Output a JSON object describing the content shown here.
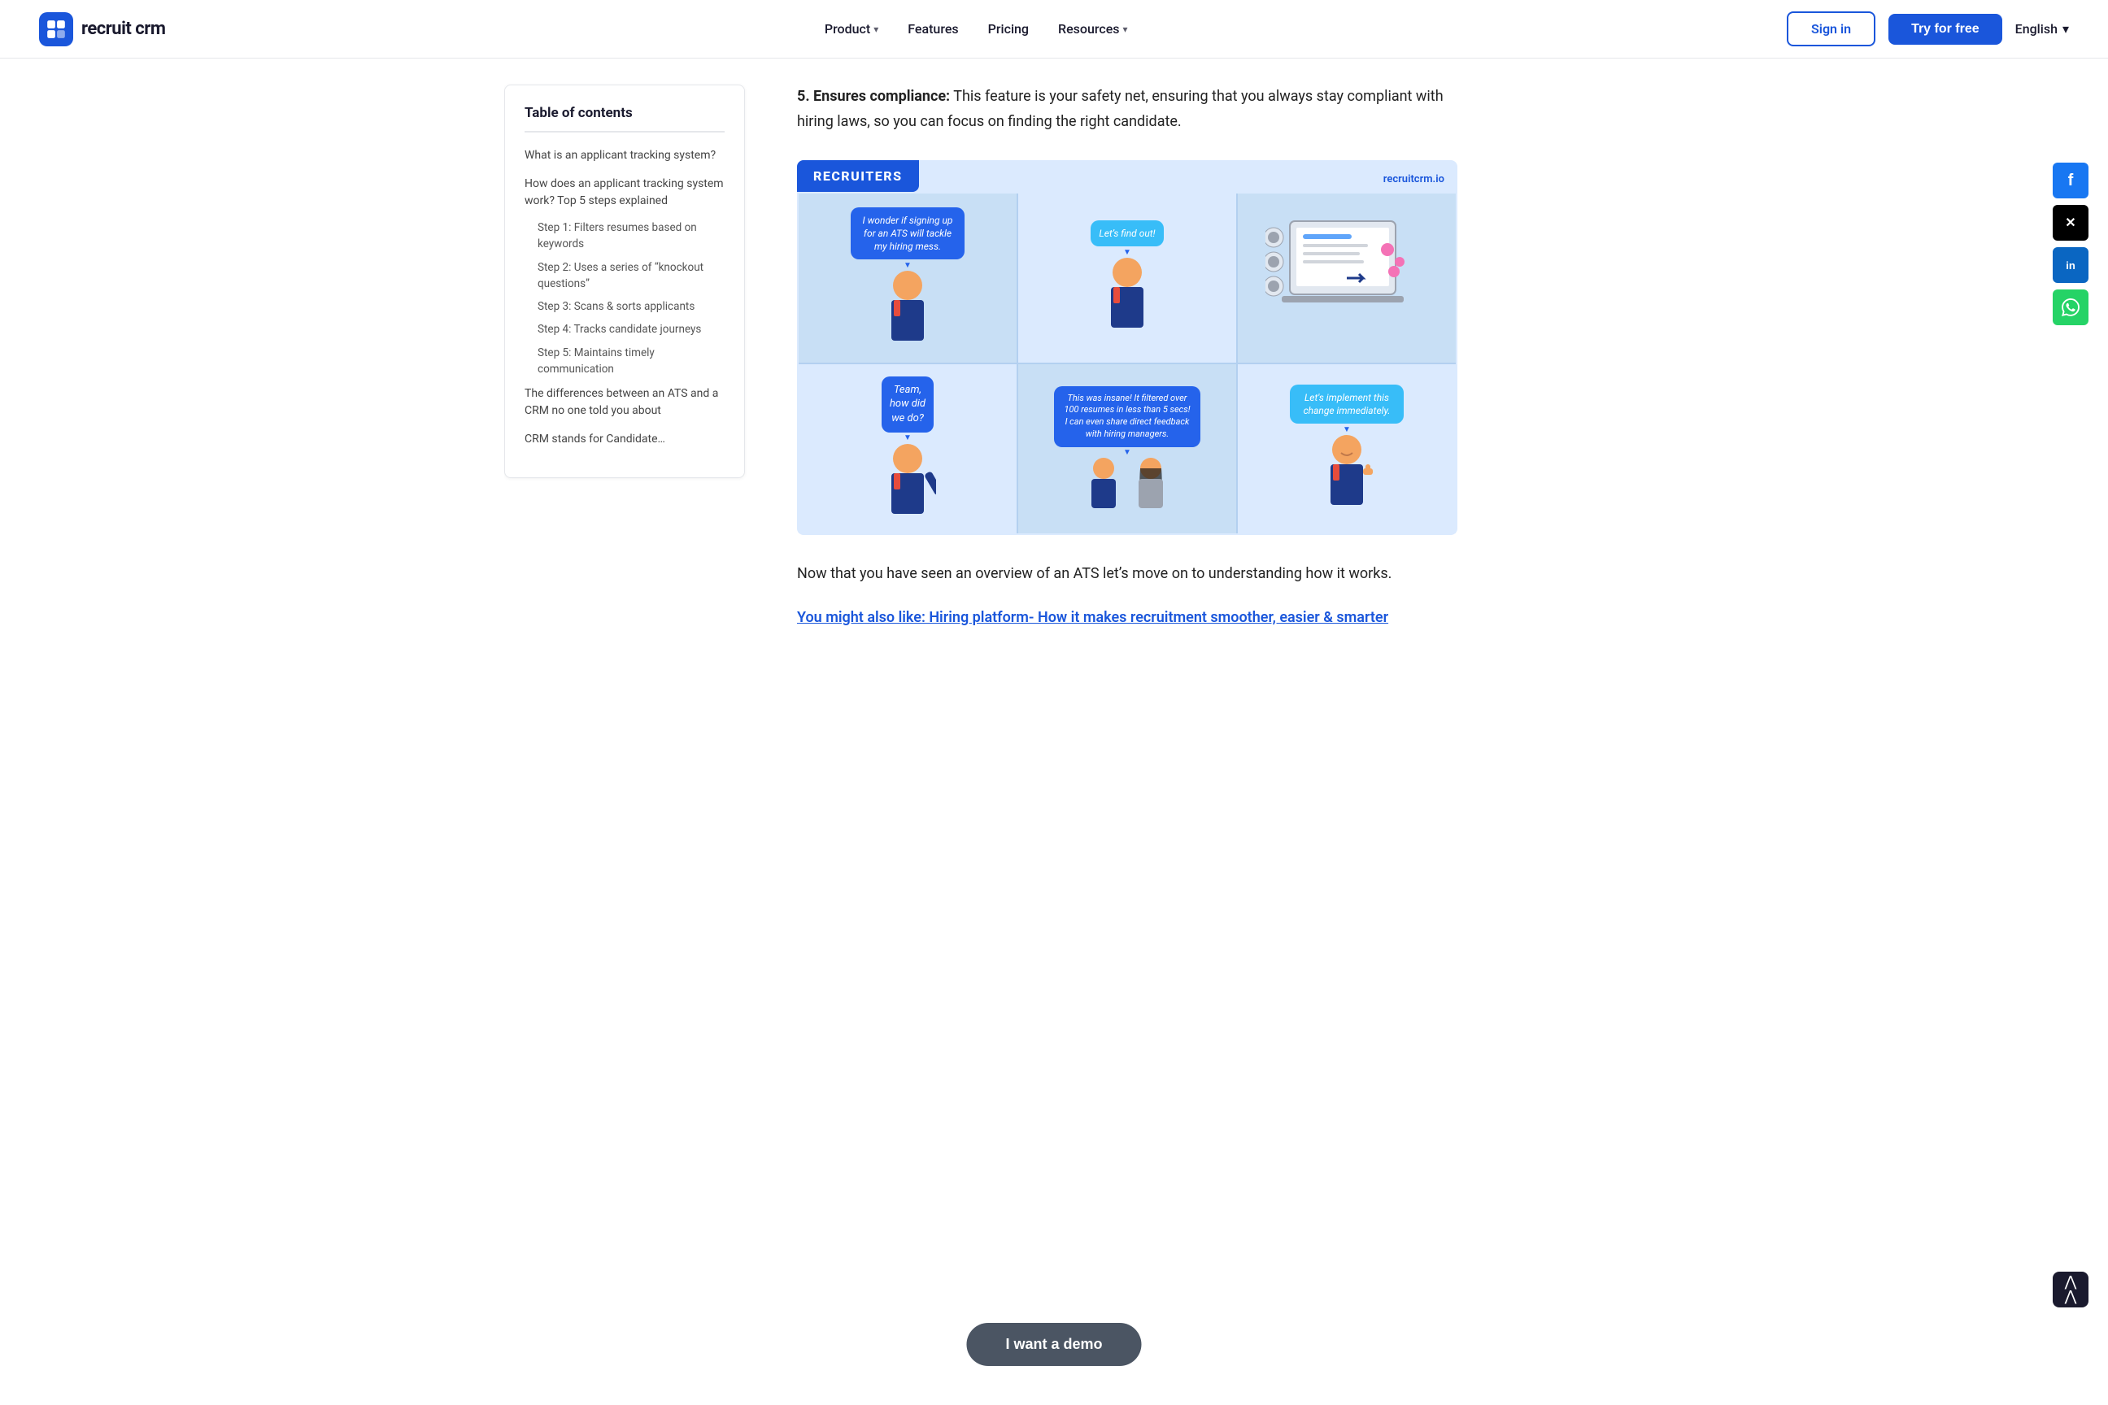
{
  "navbar": {
    "logo_text": "recruit crm",
    "nav_links": [
      {
        "label": "Product",
        "has_dropdown": true
      },
      {
        "label": "Features",
        "has_dropdown": false
      },
      {
        "label": "Pricing",
        "has_dropdown": false
      },
      {
        "label": "Resources",
        "has_dropdown": true
      }
    ],
    "signin_label": "Sign in",
    "try_label": "Try for free",
    "language": "English"
  },
  "toc": {
    "title": "Table of contents",
    "items": [
      {
        "label": "What is an applicant tracking system?",
        "indent": false
      },
      {
        "label": "How does an applicant tracking system work? Top 5 steps explained",
        "indent": false
      },
      {
        "label": "Step 1: Filters resumes based on keywords",
        "indent": true
      },
      {
        "label": "Step 2: Uses a series of “knockout questions”",
        "indent": true
      },
      {
        "label": "Step 3: Scans & sorts applicants",
        "indent": true
      },
      {
        "label": "Step 4: Tracks candidate journeys",
        "indent": true
      },
      {
        "label": "Step 5: Maintains timely communication",
        "indent": true
      },
      {
        "label": "The differences between an ATS and a CRM no one told you about",
        "indent": false
      },
      {
        "label": "CRM stands for Candidate…",
        "indent": false
      }
    ]
  },
  "content": {
    "compliance_number": "5.",
    "compliance_bold": "Ensures compliance:",
    "compliance_text": " This feature is your safety net, ensuring that you always stay compliant with hiring laws, so you can focus on finding the right candidate.",
    "recruiter_label": "RECRUITERS",
    "recruiter_watermark": "recruitcrm.io",
    "comic_panels": [
      {
        "bubble": "I wonder if signing up for an ATS will tackle my hiring mess.",
        "bubble_style": "blue",
        "char": "male_worried"
      },
      {
        "bubble": "Let’s find out!",
        "bubble_style": "sky",
        "char": "male_curious"
      },
      {
        "char": "laptop_screen",
        "bubble": null
      },
      {
        "bubble": "Team, how did we do?",
        "bubble_style": "blue",
        "char": "male_asking"
      },
      {
        "bubble": "This was insane! It filtered over 100 resumes in less than 5 secs! I can even share direct feedback with hiring managers.",
        "bubble_style": "blue",
        "char": "team_pair"
      },
      {
        "bubble": "Let’s implement this change immediately.",
        "bubble_style": "sky",
        "char": "male_happy"
      }
    ],
    "overview_text": "Now that you have seen an overview of an ATS let’s move on to understanding how it works.",
    "you_might_link": "You might also like: Hiring platform- How it makes recruitment smoother, easier & smarter"
  },
  "social": {
    "buttons": [
      {
        "label": "f",
        "platform": "facebook",
        "color": "#1877f2"
      },
      {
        "label": "✕",
        "platform": "twitter-x",
        "color": "#000"
      },
      {
        "label": "in",
        "platform": "linkedin",
        "color": "#0a66c2"
      },
      {
        "label": "✓",
        "platform": "whatsapp",
        "color": "#25d366"
      }
    ]
  },
  "demo_button": {
    "label": "I want a demo"
  },
  "scroll_top": {
    "label": "⌃⌃"
  }
}
